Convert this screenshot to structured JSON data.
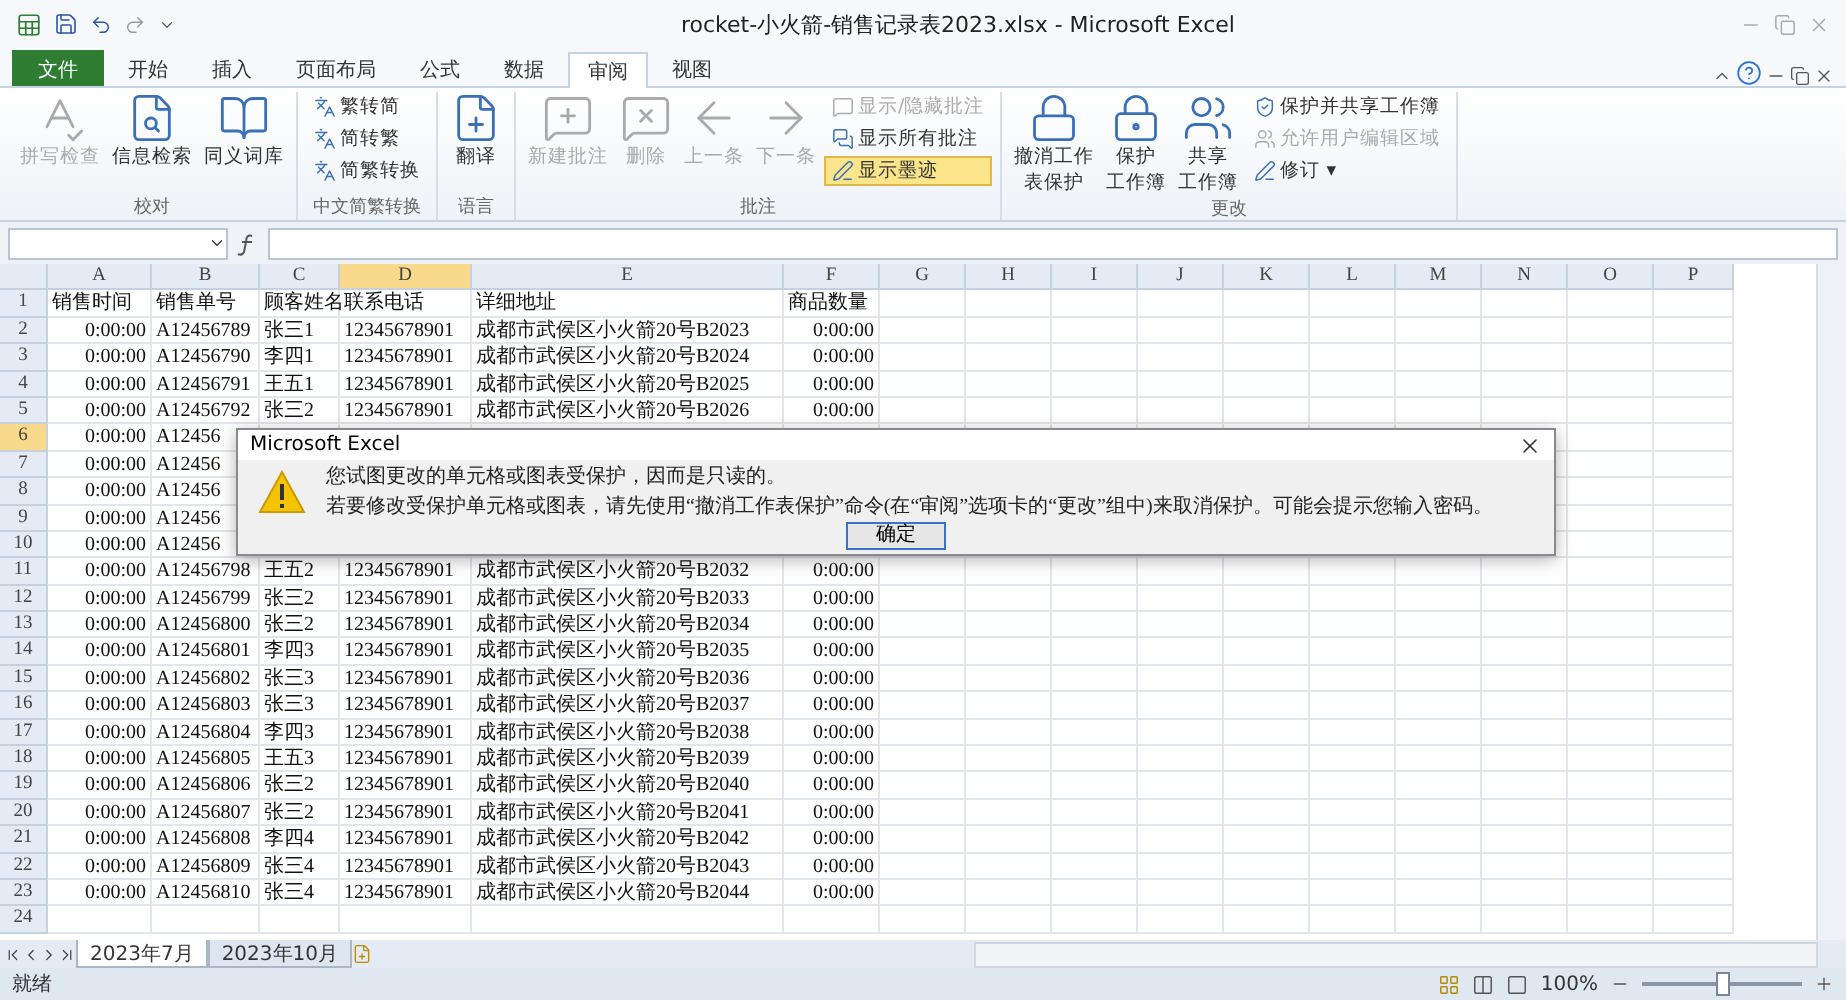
{
  "window": {
    "title": "rocket-小火箭-销售记录表2023.xlsx - Microsoft Excel"
  },
  "ribbon_tabs": [
    {
      "label": "文件",
      "kind": "file",
      "selected": false
    },
    {
      "label": "开始",
      "kind": "tab",
      "selected": false
    },
    {
      "label": "插入",
      "kind": "tab",
      "selected": false
    },
    {
      "label": "页面布局",
      "kind": "tab",
      "selected": false
    },
    {
      "label": "公式",
      "kind": "tab",
      "selected": false
    },
    {
      "label": "数据",
      "kind": "tab",
      "selected": false
    },
    {
      "label": "审阅",
      "kind": "tab",
      "selected": true
    },
    {
      "label": "视图",
      "kind": "tab",
      "selected": false
    }
  ],
  "ribbon_groups": [
    {
      "label": "校对",
      "items": [
        {
          "kind": "large",
          "lines": [
            "拼写检查"
          ],
          "disabled": true
        },
        {
          "kind": "large",
          "lines": [
            "信息检索"
          ],
          "disabled": false
        },
        {
          "kind": "large",
          "lines": [
            "同义词库"
          ],
          "disabled": false
        }
      ]
    },
    {
      "label": "中文简繁转换",
      "items": [
        {
          "kind": "small",
          "lines": [
            "繁转简"
          ],
          "disabled": false,
          "on": false
        },
        {
          "kind": "small",
          "lines": [
            "简转繁"
          ],
          "disabled": false,
          "on": false
        },
        {
          "kind": "small",
          "lines": [
            "简繁转换"
          ],
          "disabled": false,
          "on": false
        }
      ]
    },
    {
      "label": "语言",
      "items": [
        {
          "kind": "large",
          "lines": [
            "翻译"
          ],
          "disabled": false
        }
      ]
    },
    {
      "label": "批注",
      "items": [
        {
          "kind": "large",
          "lines": [
            "新建批注"
          ],
          "disabled": true
        },
        {
          "kind": "large",
          "lines": [
            "删除"
          ],
          "disabled": true
        },
        {
          "kind": "large",
          "lines": [
            "上一条"
          ],
          "disabled": true
        },
        {
          "kind": "large",
          "lines": [
            "下一条"
          ],
          "disabled": true
        },
        {
          "kind": "small",
          "lines": [
            "显示/隐藏批注"
          ],
          "disabled": true,
          "on": false
        },
        {
          "kind": "small",
          "lines": [
            "显示所有批注"
          ],
          "disabled": false,
          "on": false
        },
        {
          "kind": "small",
          "lines": [
            "显示墨迹"
          ],
          "disabled": false,
          "on": true
        }
      ]
    },
    {
      "label": "更改",
      "items": [
        {
          "kind": "large",
          "lines": [
            "撤消工作",
            "表保护"
          ],
          "disabled": false
        },
        {
          "kind": "large",
          "lines": [
            "保护",
            "工作簿"
          ],
          "disabled": false
        },
        {
          "kind": "large",
          "lines": [
            "共享",
            "工作簿"
          ],
          "disabled": false
        },
        {
          "kind": "small",
          "lines": [
            "保护并共享工作簿"
          ],
          "disabled": false,
          "on": false
        },
        {
          "kind": "small",
          "lines": [
            "允许用户编辑区域"
          ],
          "disabled": true,
          "on": false
        },
        {
          "kind": "small",
          "lines": [
            "修订 ▾"
          ],
          "disabled": false,
          "on": false
        }
      ]
    }
  ],
  "columns": [
    {
      "label": "A",
      "selected": false
    },
    {
      "label": "B",
      "selected": false
    },
    {
      "label": "C",
      "selected": false
    },
    {
      "label": "D",
      "selected": true
    },
    {
      "label": "E",
      "selected": false
    },
    {
      "label": "F",
      "selected": false
    },
    {
      "label": "G",
      "selected": false
    },
    {
      "label": "H",
      "selected": false
    },
    {
      "label": "I",
      "selected": false
    },
    {
      "label": "J",
      "selected": false
    },
    {
      "label": "K",
      "selected": false
    },
    {
      "label": "L",
      "selected": false
    },
    {
      "label": "M",
      "selected": false
    },
    {
      "label": "N",
      "selected": false
    },
    {
      "label": "O",
      "selected": false
    },
    {
      "label": "P",
      "selected": false
    }
  ],
  "rows": [
    {
      "number": "1",
      "selected": false,
      "cells": [
        "销售时间",
        "销售单号",
        "顾客姓名",
        "联系电话",
        "详细地址",
        "商品数量"
      ]
    },
    {
      "number": "2",
      "selected": false,
      "cells": [
        "0:00:00",
        "A12456789",
        "张三1",
        "12345678901",
        "成都市武侯区小火箭20号B2023",
        "0:00:00"
      ]
    },
    {
      "number": "3",
      "selected": false,
      "cells": [
        "0:00:00",
        "A12456790",
        "李四1",
        "12345678901",
        "成都市武侯区小火箭20号B2024",
        "0:00:00"
      ]
    },
    {
      "number": "4",
      "selected": false,
      "cells": [
        "0:00:00",
        "A12456791",
        "王五1",
        "12345678901",
        "成都市武侯区小火箭20号B2025",
        "0:00:00"
      ]
    },
    {
      "number": "5",
      "selected": false,
      "cells": [
        "0:00:00",
        "A12456792",
        "张三2",
        "12345678901",
        "成都市武侯区小火箭20号B2026",
        "0:00:00"
      ]
    },
    {
      "number": "6",
      "selected": true,
      "cells": [
        "0:00:00",
        "A12456"
      ]
    },
    {
      "number": "7",
      "selected": false,
      "cells": [
        "0:00:00",
        "A12456"
      ]
    },
    {
      "number": "8",
      "selected": false,
      "cells": [
        "0:00:00",
        "A12456"
      ]
    },
    {
      "number": "9",
      "selected": false,
      "cells": [
        "0:00:00",
        "A12456"
      ]
    },
    {
      "number": "10",
      "selected": false,
      "cells": [
        "0:00:00",
        "A12456"
      ]
    },
    {
      "number": "11",
      "selected": false,
      "cells": [
        "0:00:00",
        "A12456798",
        "王五2",
        "12345678901",
        "成都市武侯区小火箭20号B2032",
        "0:00:00"
      ]
    },
    {
      "number": "12",
      "selected": false,
      "cells": [
        "0:00:00",
        "A12456799",
        "张三2",
        "12345678901",
        "成都市武侯区小火箭20号B2033",
        "0:00:00"
      ]
    },
    {
      "number": "13",
      "selected": false,
      "cells": [
        "0:00:00",
        "A12456800",
        "张三2",
        "12345678901",
        "成都市武侯区小火箭20号B2034",
        "0:00:00"
      ]
    },
    {
      "number": "14",
      "selected": false,
      "cells": [
        "0:00:00",
        "A12456801",
        "李四3",
        "12345678901",
        "成都市武侯区小火箭20号B2035",
        "0:00:00"
      ]
    },
    {
      "number": "15",
      "selected": false,
      "cells": [
        "0:00:00",
        "A12456802",
        "张三3",
        "12345678901",
        "成都市武侯区小火箭20号B2036",
        "0:00:00"
      ]
    },
    {
      "number": "16",
      "selected": false,
      "cells": [
        "0:00:00",
        "A12456803",
        "张三3",
        "12345678901",
        "成都市武侯区小火箭20号B2037",
        "0:00:00"
      ]
    },
    {
      "number": "17",
      "selected": false,
      "cells": [
        "0:00:00",
        "A12456804",
        "李四3",
        "12345678901",
        "成都市武侯区小火箭20号B2038",
        "0:00:00"
      ]
    },
    {
      "number": "18",
      "selected": false,
      "cells": [
        "0:00:00",
        "A12456805",
        "王五3",
        "12345678901",
        "成都市武侯区小火箭20号B2039",
        "0:00:00"
      ]
    },
    {
      "number": "19",
      "selected": false,
      "cells": [
        "0:00:00",
        "A12456806",
        "张三2",
        "12345678901",
        "成都市武侯区小火箭20号B2040",
        "0:00:00"
      ]
    },
    {
      "number": "20",
      "selected": false,
      "cells": [
        "0:00:00",
        "A12456807",
        "张三2",
        "12345678901",
        "成都市武侯区小火箭20号B2041",
        "0:00:00"
      ]
    },
    {
      "number": "21",
      "selected": false,
      "cells": [
        "0:00:00",
        "A12456808",
        "李四4",
        "12345678901",
        "成都市武侯区小火箭20号B2042",
        "0:00:00"
      ]
    },
    {
      "number": "22",
      "selected": false,
      "cells": [
        "0:00:00",
        "A12456809",
        "张三4",
        "12345678901",
        "成都市武侯区小火箭20号B2043",
        "0:00:00"
      ]
    },
    {
      "number": "23",
      "selected": false,
      "cells": [
        "0:00:00",
        "A12456810",
        "张三4",
        "12345678901",
        "成都市武侯区小火箭20号B2044",
        "0:00:00"
      ]
    },
    {
      "number": "24",
      "selected": false,
      "cells": []
    }
  ],
  "dialog": {
    "title": "Microsoft Excel",
    "message": "您试图更改的单元格或图表受保护，因而是只读的。",
    "detail": "若要修改受保护单元格或图表，请先使用“撤消工作表保护”命令(在“审阅”选项卡的“更改”组中)来取消保护。可能会提示您输入密码。",
    "button": "确定"
  },
  "sheet_tabs": [
    {
      "label": "2023年7月",
      "selected": true
    },
    {
      "label": "2023年10月",
      "selected": false
    }
  ],
  "status_bar": {
    "status": "就绪",
    "zoom": "100%",
    "zoom_slider": {
      "level": 0.5
    }
  }
}
